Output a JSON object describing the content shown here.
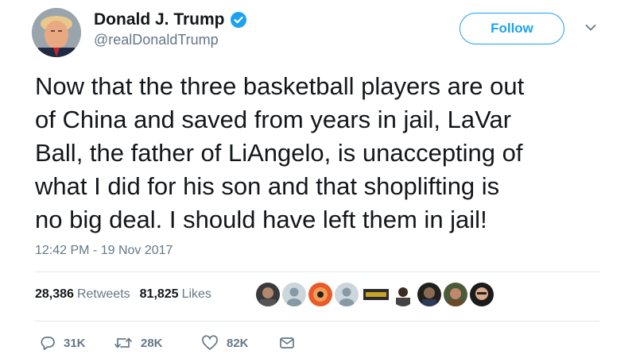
{
  "user": {
    "display_name": "Donald J. Trump",
    "handle": "@realDonaldTrump",
    "verified": true
  },
  "follow_label": "Follow",
  "tweet": {
    "text": "Now that the three basketball players are out\nof China and saved from years in jail, LaVar\nBall, the father of LiAngelo, is unaccepting of\nwhat I did for his son and that shoplifting is\nno big deal. I should have left them in jail!",
    "timestamp": "12:42 PM - 19 Nov 2017"
  },
  "stats": {
    "retweets_count": "28,386",
    "retweets_label": "Retweets",
    "likes_count": "81,825",
    "likes_label": "Likes"
  },
  "actions": {
    "replies": "31K",
    "retweets": "28K",
    "likes": "82K"
  },
  "colors": {
    "accent": "#1da1f2",
    "secondary_text": "#657786",
    "divider": "#e1e8ed"
  }
}
